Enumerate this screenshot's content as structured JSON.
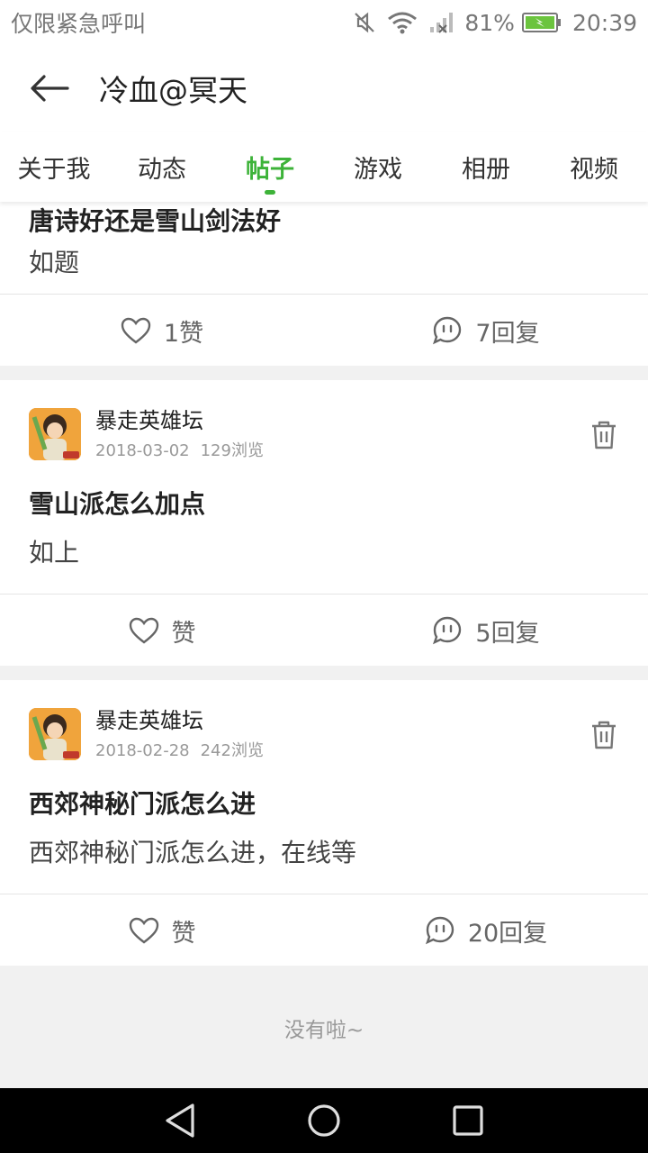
{
  "status_bar": {
    "notice": "仅限紧急呼叫",
    "battery": "81%",
    "time": "20:39"
  },
  "header": {
    "title": "冷血@冥天"
  },
  "tabs": [
    {
      "label": "关于我"
    },
    {
      "label": "动态"
    },
    {
      "label": "帖子"
    },
    {
      "label": "游戏"
    },
    {
      "label": "相册"
    },
    {
      "label": "视频"
    }
  ],
  "posts": [
    {
      "title": "唐诗好还是雪山剑法好",
      "body": "如题",
      "likes": "1赞",
      "replies": "7回复"
    },
    {
      "author": "暴走英雄坛",
      "date": "2018-03-02",
      "views": "129浏览",
      "title": "雪山派怎么加点",
      "body": "如上",
      "likes": "赞",
      "replies": "5回复"
    },
    {
      "author": "暴走英雄坛",
      "date": "2018-02-28",
      "views": "242浏览",
      "title": "西郊神秘门派怎么进",
      "body": "西郊神秘门派怎么进，在线等",
      "likes": "赞",
      "replies": "20回复"
    }
  ],
  "footer": {
    "no_more": "没有啦~"
  },
  "colors": {
    "accent": "#3db339",
    "battery": "#6bc43e"
  }
}
